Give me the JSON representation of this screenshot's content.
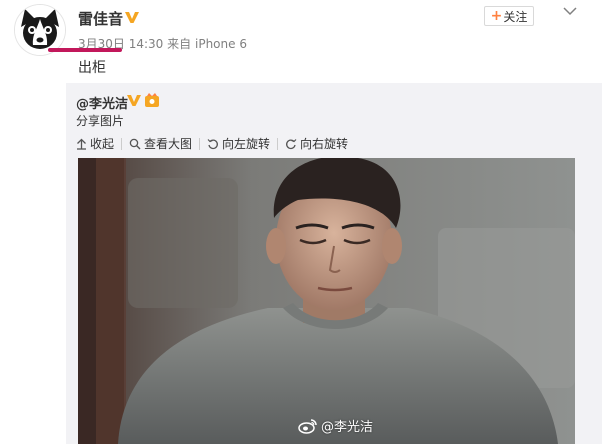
{
  "post": {
    "username": "雷佳音",
    "date": "3月30日",
    "time": "14:30",
    "source_prefix": "来自",
    "device": "iPhone 6",
    "text": "出柜",
    "follow_plus": "+",
    "follow_label": "关注"
  },
  "repost": {
    "author": "@李光洁",
    "text": "分享图片",
    "toolbar": {
      "collapse": "收起",
      "view_large": "查看大图",
      "rotate_left": "向左旋转",
      "rotate_right": "向右旋转"
    },
    "watermark": "@李光洁"
  },
  "colors": {
    "accent_orange": "#ff8140",
    "verified_gold": "#f5a623",
    "highlight_mark": "#c2185b",
    "repost_bg": "#f2f2f5"
  },
  "icons": {
    "verified": "verified-v-icon",
    "follow": "plus-icon",
    "menu": "chevron-down-icon",
    "collapse": "arrow-up-icon",
    "view_large": "search-icon",
    "rotate_left": "rotate-left-icon",
    "rotate_right": "rotate-right-icon",
    "watermark": "weibo-logo-icon"
  }
}
